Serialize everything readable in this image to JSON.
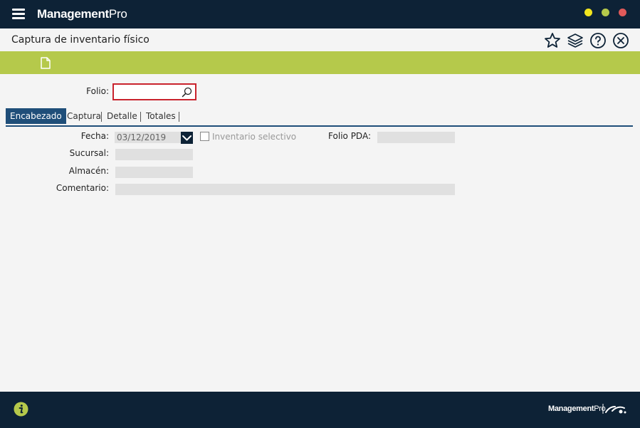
{
  "app": {
    "brand_bold": "Management",
    "brand_light": "Pro"
  },
  "window_controls": {
    "colors": [
      "#f2e51e",
      "#b5c94b",
      "#e05a5a"
    ]
  },
  "header": {
    "title": "Captura de inventario físico"
  },
  "header_icons": [
    "star-icon",
    "layers-icon",
    "help-icon",
    "close-icon"
  ],
  "toolbar": {
    "icons": [
      "new-document-icon"
    ]
  },
  "folio": {
    "label": "Folio:",
    "value": "",
    "placeholder": ""
  },
  "tabs": [
    {
      "label": "Encabezado",
      "active": true
    },
    {
      "label": "Captura",
      "active": false
    },
    {
      "label": "Detalle",
      "active": false
    },
    {
      "label": "Totales",
      "active": false
    }
  ],
  "form": {
    "fecha": {
      "label": "Fecha:",
      "value": "03/12/2019"
    },
    "inventario_selectivo": {
      "label": "Inventario selectivo",
      "checked": false
    },
    "folio_pda": {
      "label": "Folio PDA:",
      "value": ""
    },
    "sucursal": {
      "label": "Sucursal:",
      "value": ""
    },
    "almacen": {
      "label": "Almacén:",
      "value": ""
    },
    "comentario": {
      "label": "Comentario:",
      "value": ""
    }
  },
  "footer": {
    "brand_bold": "Management",
    "brand_light": "Pro"
  },
  "colors": {
    "navy": "#0d2236",
    "accent_green": "#b5c94b",
    "tab_blue": "#1f4e79",
    "folio_border": "#c9232d"
  }
}
